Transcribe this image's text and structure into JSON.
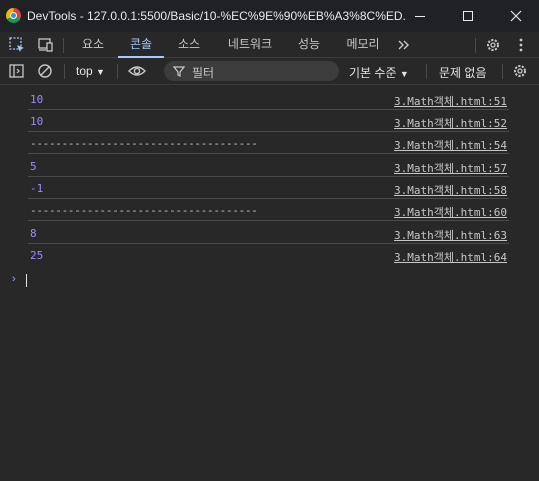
{
  "window": {
    "title": "DevTools - 127.0.0.1:5500/Basic/10-%EC%9E%90%EB%A3%8C%ED..."
  },
  "tabs": [
    {
      "label": "요소",
      "active": false
    },
    {
      "label": "콘솔",
      "active": true
    },
    {
      "label": "소스",
      "active": false
    },
    {
      "label": "네트워크",
      "active": false
    },
    {
      "label": "성능",
      "active": false
    },
    {
      "label": "메모리",
      "active": false
    }
  ],
  "toolbar": {
    "context": "top",
    "filter_placeholder": "필터",
    "log_level": "기본 수준",
    "issues": "문제 없음"
  },
  "console": {
    "rows": [
      {
        "message": "10",
        "source": "3.Math객체.html:51"
      },
      {
        "message": "10",
        "source": "3.Math객체.html:52"
      },
      {
        "message": "------------------------------------",
        "source": "3.Math객체.html:54"
      },
      {
        "message": "5",
        "source": "3.Math객체.html:57"
      },
      {
        "message": "-1",
        "source": "3.Math객체.html:58"
      },
      {
        "message": "------------------------------------",
        "source": "3.Math객체.html:60"
      },
      {
        "message": "8",
        "source": "3.Math객체.html:63"
      },
      {
        "message": "25",
        "source": "3.Math객체.html:64"
      }
    ],
    "prompt": "›"
  },
  "colors": {
    "accent": "#a8c7fa",
    "number": "#9a8cff",
    "background": "#282828"
  }
}
